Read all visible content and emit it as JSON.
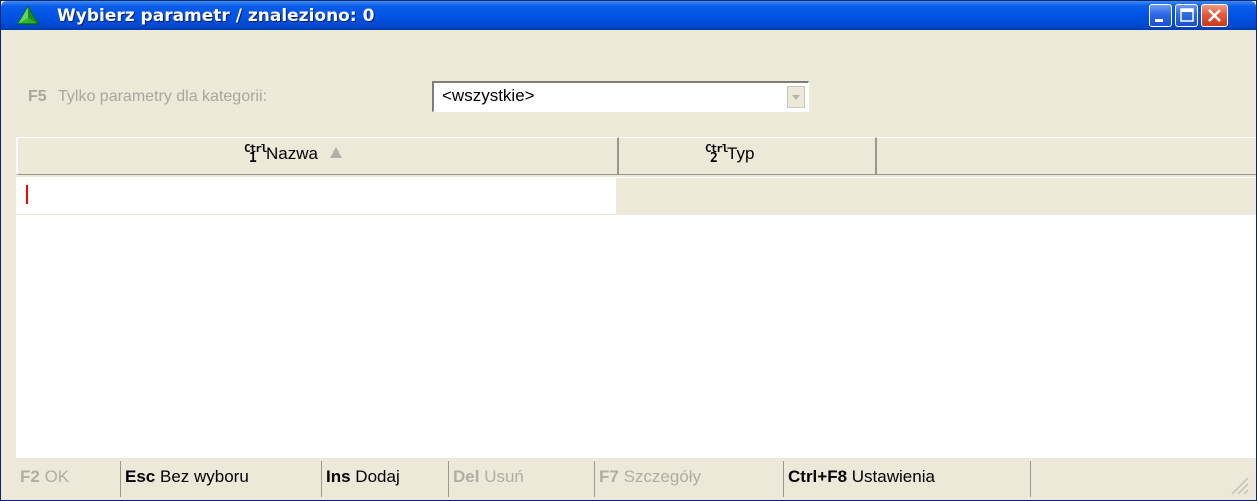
{
  "window": {
    "title": "Wybierz parametr / znaleziono: 0",
    "app_icon": "green-pyramid-icon",
    "title_bar_colors": {
      "start": "#3b8cf5",
      "end": "#003cb0"
    },
    "buttons": {
      "minimize": "minimize-icon",
      "maximize": "maximize-icon",
      "close": "close-icon"
    }
  },
  "filter": {
    "key": "F5",
    "label": "Tylko parametry dla kategorii:",
    "selected_value": "<wszystkie>"
  },
  "table": {
    "columns": [
      {
        "ctrl_top": "Ctrl",
        "ctrl_num": "1",
        "label": "Nazwa",
        "sort": "ascending"
      },
      {
        "ctrl_top": "Ctrl",
        "ctrl_num": "2",
        "label": "Typ"
      }
    ],
    "rows": []
  },
  "footer": {
    "buttons": [
      {
        "key": "F2",
        "label": "OK",
        "enabled": false
      },
      {
        "key": "Esc",
        "label": "Bez wyboru",
        "enabled": true
      },
      {
        "key": "Ins",
        "label": "Dodaj",
        "enabled": true
      },
      {
        "key": "Del",
        "label": "Usuń",
        "enabled": false
      },
      {
        "key": "F7",
        "label": "Szczegóły",
        "enabled": false
      },
      {
        "key": "Ctrl+F8",
        "label": "Ustawienia",
        "enabled": true
      }
    ]
  },
  "colors": {
    "panel": "#ece9d8",
    "cursor": "#ff0000",
    "disabled_text": "#b0ada4"
  }
}
